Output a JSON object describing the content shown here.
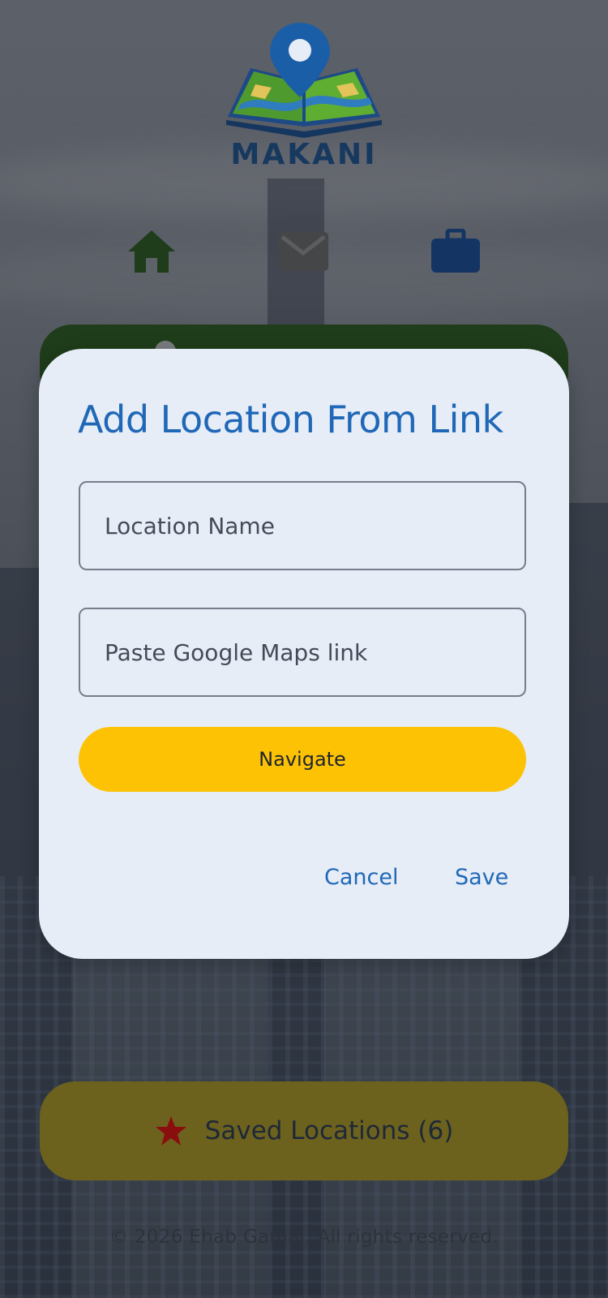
{
  "app": {
    "logo_text": "MAKANI"
  },
  "nav": {
    "items": [
      {
        "icon": "home-icon",
        "color": "#1f3d1a"
      },
      {
        "icon": "mail-icon",
        "color": "#444648"
      },
      {
        "icon": "briefcase-icon",
        "color": "#143563"
      }
    ]
  },
  "dialog": {
    "title": "Add Location From Link",
    "name_placeholder": "Location Name",
    "link_placeholder": "Paste Google Maps link",
    "navigate_label": "Navigate",
    "cancel_label": "Cancel",
    "save_label": "Save"
  },
  "saved": {
    "label": "Saved Locations (6)",
    "icon": "star-icon",
    "icon_color": "#8b0e0e"
  },
  "footer": {
    "text": "© 2026 Ehab Gamal. All rights reserved."
  },
  "colors": {
    "accent": "#2068b7",
    "navigate": "#fcc203",
    "saved_bg": "#6c621e",
    "dialog_bg": "#e6edf7"
  }
}
